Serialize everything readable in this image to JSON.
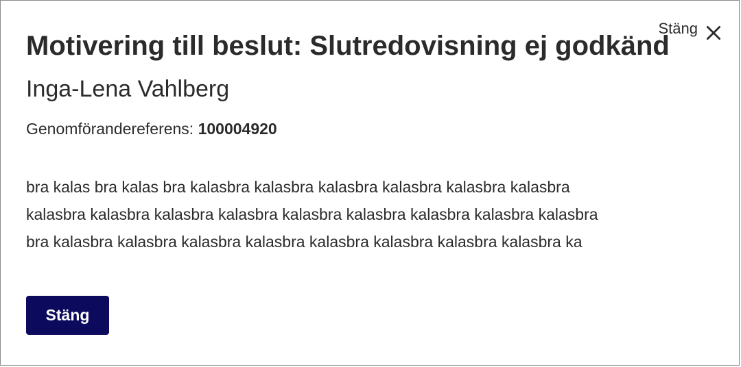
{
  "dialog": {
    "title": "Motivering till beslut: Slutredovisning ej godkänd",
    "person_name": "Inga-Lena Vahlberg",
    "reference_label": "Genomförandereferens:",
    "reference_value": "100004920",
    "motivation_lines": [
      "bra kalas bra kalas bra kalasbra kalasbra kalasbra kalasbra kalasbra kalasbra",
      "kalasbra kalasbra kalasbra kalasbra kalasbra kalasbra kalasbra kalasbra kalasbra",
      "bra kalasbra kalasbra kalasbra kalasbra kalasbra kalasbra kalasbra kalasbra ka"
    ],
    "close_top_label": "Stäng",
    "close_icon": "close-x-icon",
    "close_button_label": "Stäng"
  },
  "colors": {
    "primary_button": "#0b0a5c",
    "text": "#2b2b2b",
    "border": "#8a8a8a"
  }
}
